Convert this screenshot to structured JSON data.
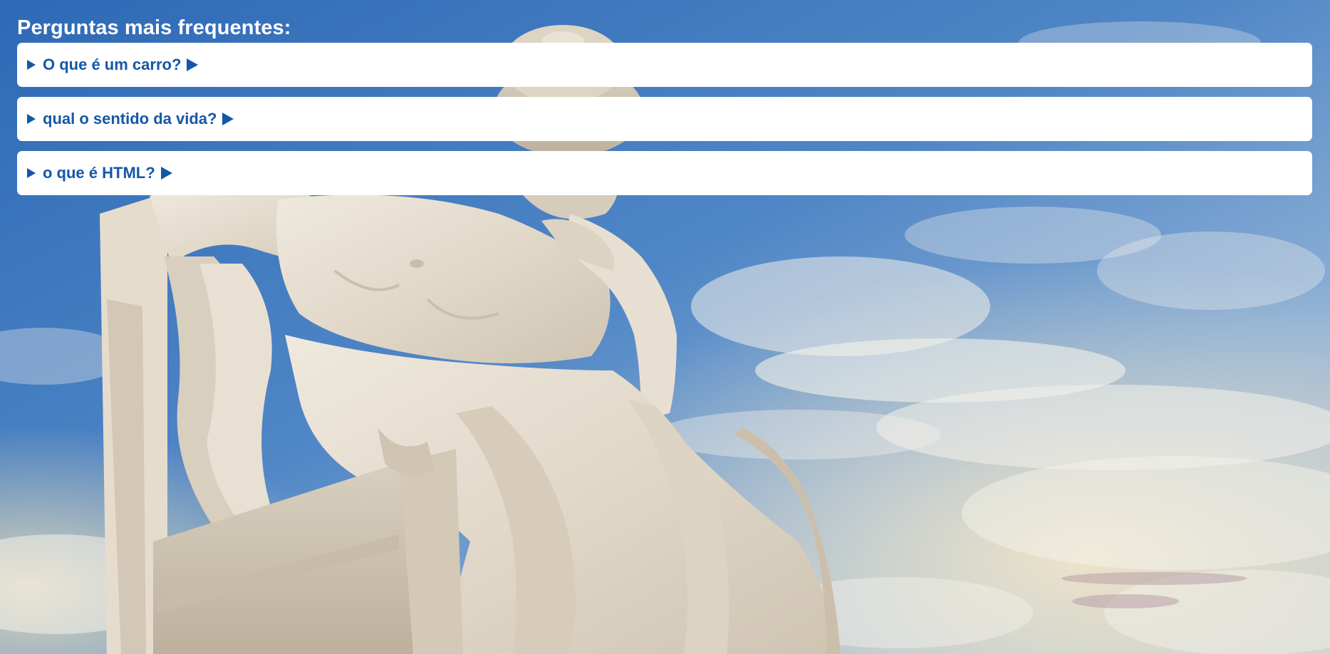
{
  "faq": {
    "title": "Perguntas mais frequentes:",
    "items": [
      {
        "question": "O que é um carro?"
      },
      {
        "question": "qual o sentido da vida?"
      },
      {
        "question": "o que é HTML?"
      }
    ]
  },
  "background": {
    "subject": "marble statue of seated philosopher against cloudy blue sky",
    "sky_color": "#3f77bd",
    "cloud_color": "#f1ede2",
    "marble_color": "#e6dfd2",
    "accent_color": "#1457a8"
  }
}
